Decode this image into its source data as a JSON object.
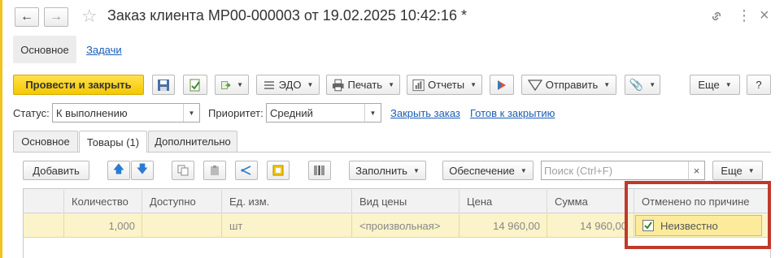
{
  "window": {
    "title": "Заказ клиента МР00-000003 от 19.02.2025 10:42:16 *"
  },
  "nav": {
    "sections": [
      "Основное",
      "Задачи"
    ]
  },
  "toolbar": {
    "post_close": "Провести и закрыть",
    "edo": "ЭДО",
    "print": "Печать",
    "reports": "Отчеты",
    "send": "Отправить",
    "more": "Еще",
    "help": "?"
  },
  "status_row": {
    "status_label": "Статус:",
    "status_value": "К выполнению",
    "priority_label": "Приоритет:",
    "priority_value": "Средний",
    "close_order_link": "Закрыть заказ",
    "ready_link": "Готов к закрытию"
  },
  "tabs": [
    "Основное",
    "Товары (1)",
    "Дополнительно"
  ],
  "goods_toolbar": {
    "add": "Добавить",
    "fill": "Заполнить",
    "supply": "Обеспечение",
    "search_placeholder": "Поиск (Ctrl+F)",
    "clear": "×",
    "more": "Еще"
  },
  "table": {
    "columns": [
      "Количество",
      "Доступно",
      "Ед. изм.",
      "Вид цены",
      "Цена",
      "Сумма",
      "Отменено по причине"
    ],
    "rows": [
      {
        "quantity": "1,000",
        "available": "",
        "unit": "шт",
        "price_type": "<произвольная>",
        "price": "14 960,00",
        "sum": "14 960,00",
        "cancel_checked": true,
        "cancel_reason": "Неизвестно"
      }
    ]
  },
  "colors": {
    "accent_yellow": "#f5d21a",
    "row_highlight": "#fbf3c9",
    "annotation_red": "#c0392b",
    "link_blue": "#1a5fb4"
  }
}
